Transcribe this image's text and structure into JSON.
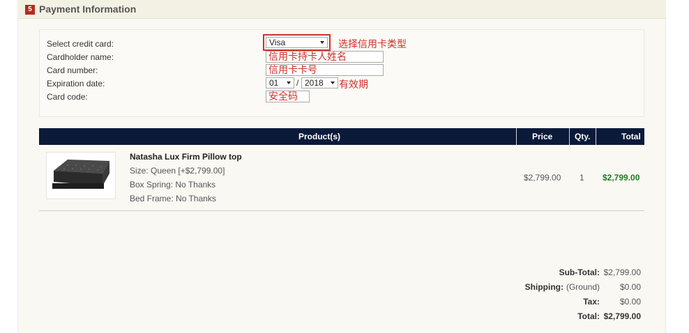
{
  "section": {
    "step": "5",
    "title": "Payment Information"
  },
  "form": {
    "labels": {
      "credit_card": "Select credit card:",
      "cardholder": "Cardholder name:",
      "card_number": "Card number:",
      "expiration": "Expiration date:",
      "card_code": "Card code:"
    },
    "card_type_value": "Visa",
    "cardholder_value": "信用卡持卡人姓名",
    "card_number_value": "信用卡卡号",
    "exp_month_value": "01",
    "exp_separator": "/",
    "exp_year_value": "2018",
    "card_code_value": "安全码"
  },
  "annotations": {
    "card_type": "选择信用卡类型",
    "expiration": "有效期"
  },
  "table": {
    "headers": {
      "products": "Product(s)",
      "price": "Price",
      "qty": "Qty.",
      "total": "Total"
    },
    "rows": [
      {
        "name": "Natasha Lux Firm Pillow top",
        "details": [
          "Size: Queen [+$2,799.00]",
          "Box Spring: No Thanks",
          "Bed Frame: No Thanks"
        ],
        "price": "$2,799.00",
        "qty": "1",
        "total": "$2,799.00"
      }
    ]
  },
  "summary": {
    "subtotal_label": "Sub-Total:",
    "subtotal_value": "$2,799.00",
    "shipping_label": "Shipping:",
    "shipping_method": "(Ground)",
    "shipping_value": "$0.00",
    "tax_label": "Tax:",
    "tax_value": "$0.00",
    "total_label": "Total:",
    "total_value": "$2,799.00"
  },
  "colors": {
    "accent_red": "#d0302a",
    "header_navy": "#0c1a3a",
    "total_green": "#1f7a1f",
    "badge_red": "#b52a1f"
  }
}
